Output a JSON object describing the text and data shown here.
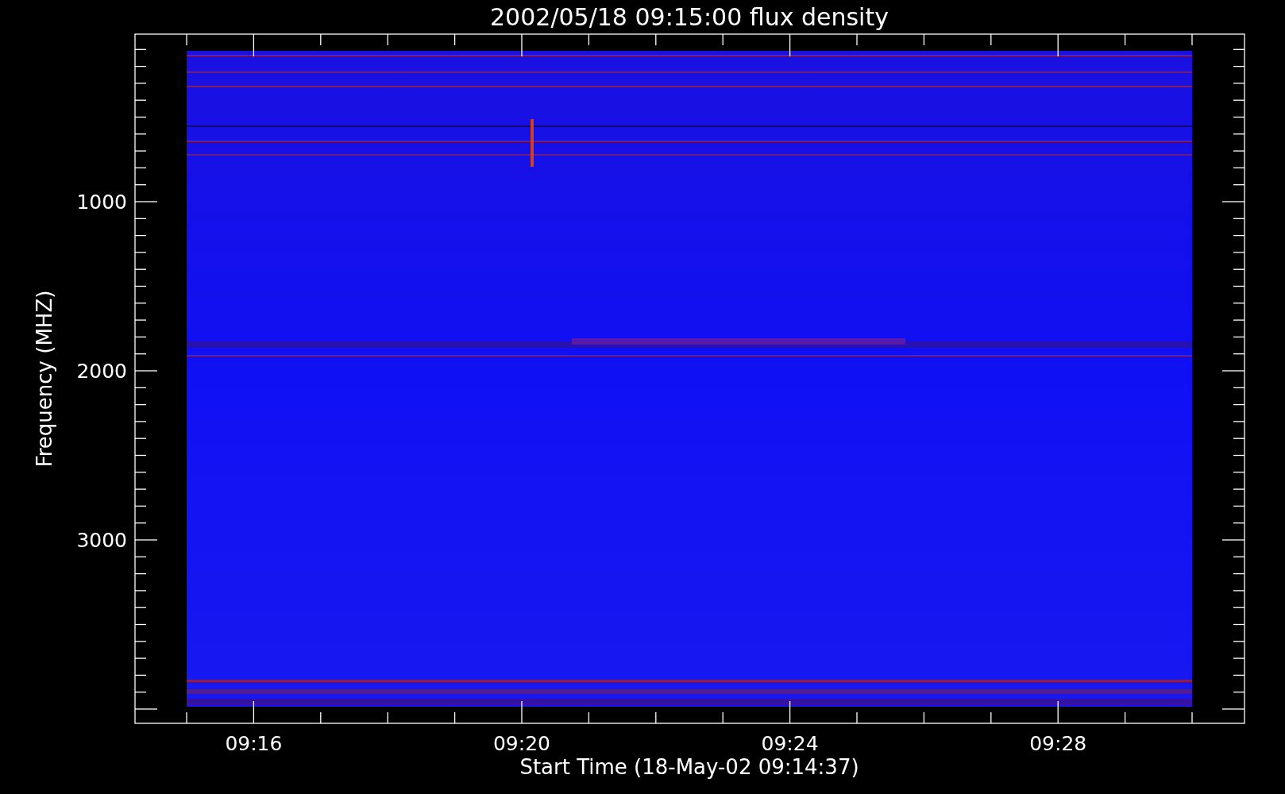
{
  "title": "2002/05/18 09:15:00 flux density",
  "y_axis": {
    "title": "Frequency (MHZ)",
    "tick_labels": [
      "1000",
      "2000",
      "3000"
    ]
  },
  "x_axis": {
    "title": "Start Time (18-May-02 09:14:37)",
    "tick_labels": [
      "09:16",
      "09:20",
      "09:24",
      "09:28"
    ]
  }
}
